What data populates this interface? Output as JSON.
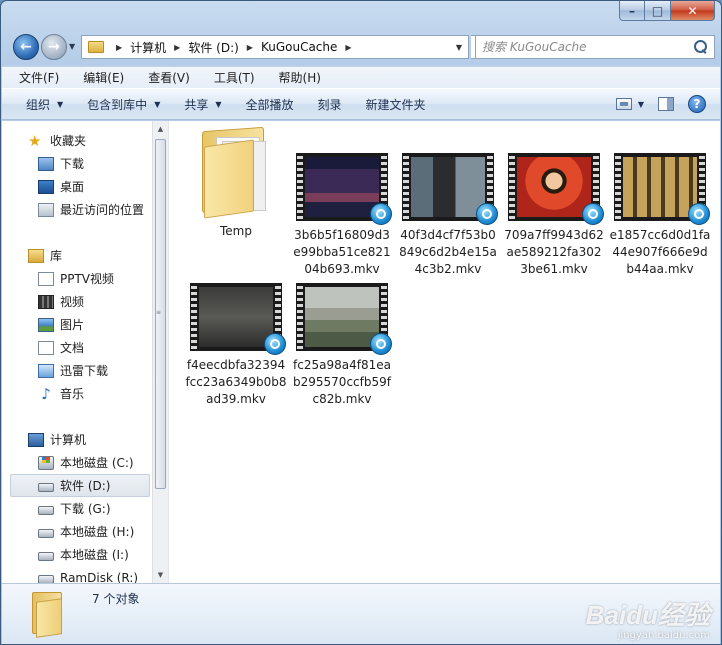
{
  "address_bar": {
    "crumbs": [
      "计算机",
      "软件 (D:)",
      "KuGouCache"
    ]
  },
  "search": {
    "placeholder": "搜索 KuGouCache"
  },
  "menu": [
    "文件(F)",
    "编辑(E)",
    "查看(V)",
    "工具(T)",
    "帮助(H)"
  ],
  "toolbar": {
    "organize": "组织",
    "include_in_library": "包含到库中",
    "share": "共享",
    "play_all": "全部播放",
    "burn": "刻录",
    "new_folder": "新建文件夹"
  },
  "nav": {
    "favorites": {
      "label": "收藏夹",
      "items": [
        "下载",
        "桌面",
        "最近访问的位置"
      ]
    },
    "libraries": {
      "label": "库",
      "items": [
        "PPTV视频",
        "视频",
        "图片",
        "文档",
        "迅雷下载",
        "音乐"
      ]
    },
    "computer": {
      "label": "计算机",
      "items": [
        "本地磁盘 (C:)",
        "软件 (D:)",
        "下载 (G:)",
        "本地磁盘 (H:)",
        "本地磁盘 (I:)",
        "RamDisk (R:)"
      ],
      "selected": "软件 (D:)"
    }
  },
  "files": [
    {
      "name": "Temp",
      "kind": "folder"
    },
    {
      "name": "3b6b5f16809d3e99bba51ce82104b693.mkv",
      "kind": "video"
    },
    {
      "name": "40f3d4cf7f53b0849c6d2b4e15a4c3b2.mkv",
      "kind": "video"
    },
    {
      "name": "709a7ff9943d62ae589212fa3023be61.mkv",
      "kind": "video"
    },
    {
      "name": "e1857cc6d0d1fa44e907f666e9db44aa.mkv",
      "kind": "video"
    },
    {
      "name": "f4eecdbfa32394fcc23a6349b0b8ad39.mkv",
      "kind": "video"
    },
    {
      "name": "fc25a98a4f81eab295570ccfb59fc82b.mkv",
      "kind": "video"
    }
  ],
  "status": {
    "count_text": "7 个对象"
  },
  "watermark": {
    "main": "Baidu经验",
    "sub": "jingyan.baidu.com"
  },
  "icons": {
    "back": "back-arrow-icon",
    "forward": "forward-arrow-icon",
    "refresh": "refresh-icon",
    "search": "search-icon",
    "help": "help-icon",
    "views": "views-icon",
    "preview_pane": "preview-pane-icon"
  }
}
